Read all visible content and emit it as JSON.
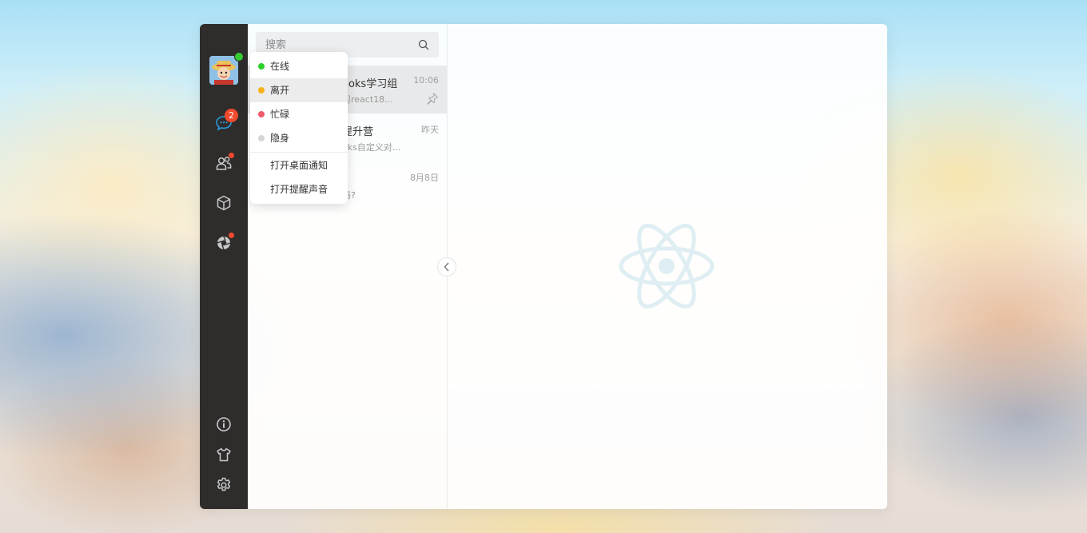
{
  "search": {
    "placeholder": "搜索"
  },
  "nav": {
    "unread_count": "2",
    "colors": {
      "sidebar": "#2f2c2c",
      "badge": "#f24a2d",
      "online": "#33cc33"
    },
    "icons": [
      "chat-icon",
      "contacts-icon",
      "cube-icon",
      "moments-icon",
      "info-icon",
      "shirt-icon",
      "settings-icon"
    ]
  },
  "sessions": [
    {
      "title": "ooks学习组",
      "subtitle": "习react18...",
      "time": "10:06",
      "pinned": true
    },
    {
      "title": "提升营",
      "subtitle": "oks自定义对...",
      "time": "昨天"
    },
    {
      "title": "",
      "subtitle": "吗?",
      "time": "8月8日"
    }
  ],
  "status_menu": {
    "items": [
      {
        "label": "在线",
        "color": "#2bd02b"
      },
      {
        "label": "离开",
        "color": "#f5b21a"
      },
      {
        "label": "忙碌",
        "color": "#ef5a6a"
      },
      {
        "label": "隐身",
        "color": "#d6d6d6"
      }
    ],
    "actions": [
      {
        "label": "打开桌面通知"
      },
      {
        "label": "打开提醒声音"
      }
    ]
  }
}
